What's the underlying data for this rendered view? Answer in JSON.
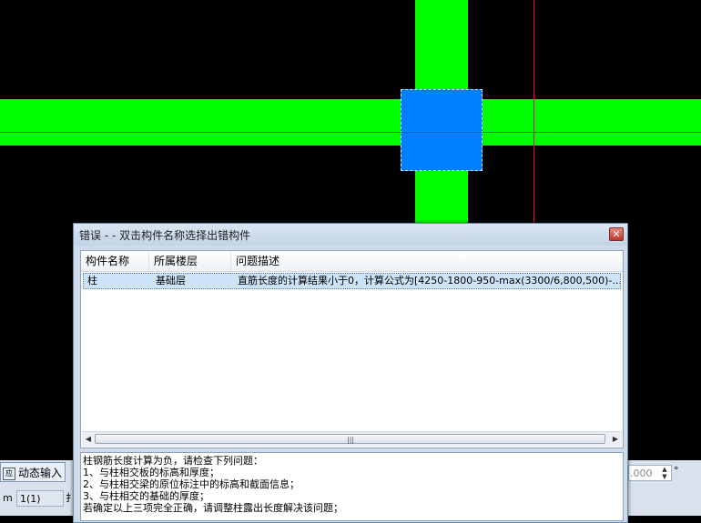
{
  "dialog": {
    "title": "错误 - - 双击构件名称选择出错构件",
    "close_glyph": "✕",
    "columns": [
      "构件名称",
      "所属楼层",
      "问题描述"
    ],
    "rows": [
      {
        "component": "柱",
        "floor": "基础层",
        "description": "直筋长度的计算结果小于0，计算公式为[4250-1800-950-max(3300/6,800,500)-..."
      }
    ],
    "scroll_left": "◀",
    "scroll_right": "▶",
    "scroll_grip": "|||",
    "message": [
      "柱钢筋长度计算为负，请检查下列问题：",
      "1、与柱相交板的标高和厚度；",
      "2、与柱相交梁的原位标注中的标高和截面信息；",
      "3、与柱相交的基础的厚度；",
      "若确定以上三项完全正确，请调整柱露出长度解决该问题；"
    ]
  },
  "status": {
    "dynamic_input_label": "动态输入",
    "dynamic_input_icon": "应",
    "cell_m": "m",
    "cell_layer": "1(1)",
    "cell_k": "扌",
    "angle_value": ".000",
    "angle_unit": "°",
    "spin_up": "▲",
    "spin_down": "▼"
  },
  "colors": {
    "beam": "#00ff00",
    "column": "#0080ff",
    "axis": "#e01010",
    "background": "#000000"
  }
}
